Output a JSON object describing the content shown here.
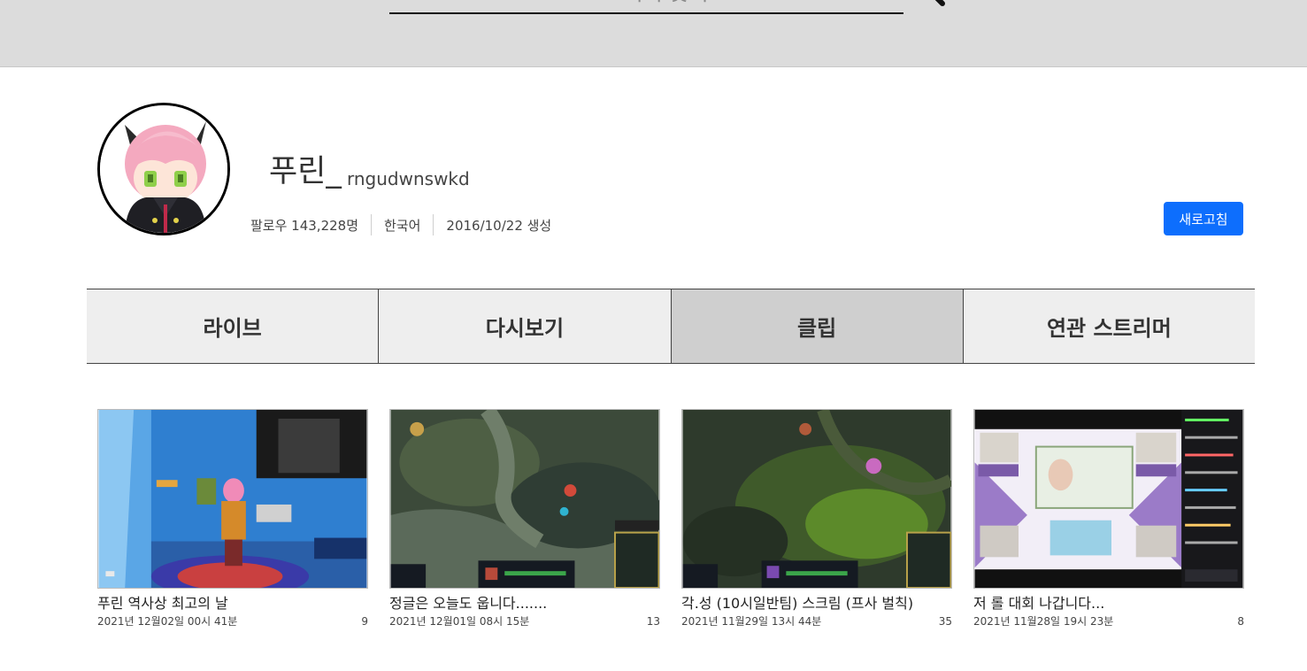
{
  "search": {
    "placeholder": "스트리머 찾기"
  },
  "profile": {
    "display_name": "푸린_",
    "login_id": "rngudwnswkd",
    "followers": "팔로우 143,228명",
    "language": "한국어",
    "created": "2016/10/22 생성",
    "refresh_label": "새로고침"
  },
  "tabs": [
    {
      "label": "라이브",
      "active": false
    },
    {
      "label": "다시보기",
      "active": false
    },
    {
      "label": "클립",
      "active": true
    },
    {
      "label": "연관 스트리머",
      "active": false
    }
  ],
  "clips": [
    {
      "title": "푸린 역사상 최고의 날",
      "date": "2021년 12월02일 00시 41분",
      "views": "9"
    },
    {
      "title": "정글은 오늘도 웁니다.......",
      "date": "2021년 12월01일 08시 15분",
      "views": "13"
    },
    {
      "title": "각.성 (10시일반팀) 스크림 (프사 벌칙)",
      "date": "2021년 11월29일 13시 44분",
      "views": "35"
    },
    {
      "title": "저 롤 대회 나갑니다...",
      "date": "2021년 11월28일 19시 23분",
      "views": "8"
    }
  ],
  "colors": {
    "accent": "#0d6efd",
    "topbar": "#dcdcdc",
    "tab_bg": "#eeeeee",
    "tab_active_bg": "#cfcfcf"
  }
}
